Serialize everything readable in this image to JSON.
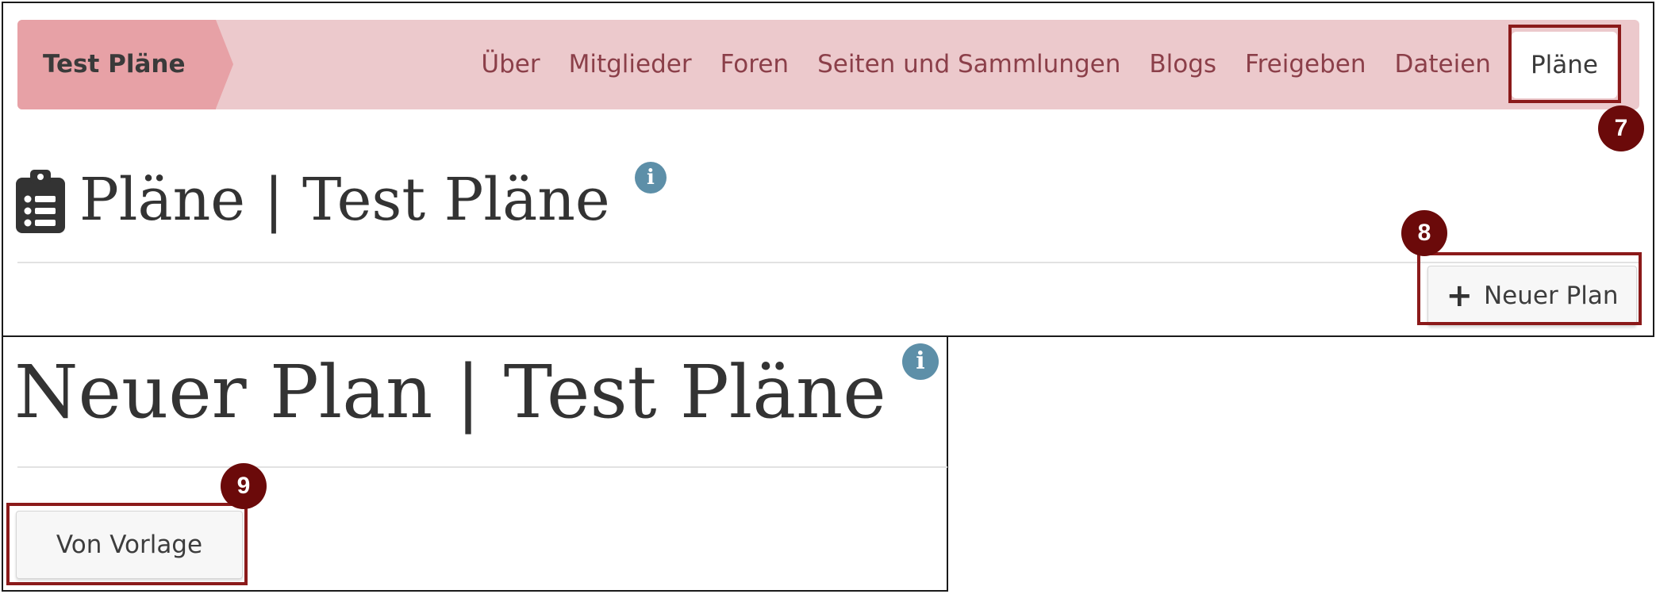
{
  "nav": {
    "group_name": "Test Pläne",
    "items": [
      "Über",
      "Mitglieder",
      "Foren",
      "Seiten und Sammlungen",
      "Blogs",
      "Freigeben",
      "Dateien"
    ],
    "active": "Pläne"
  },
  "top": {
    "heading": "Pläne | Test Pläne",
    "info_icon": "i",
    "new_plan_button": "Neuer Plan"
  },
  "bottom": {
    "heading": "Neuer Plan | Test Pläne",
    "info_icon": "i",
    "template_button": "Von Vorlage"
  },
  "annotations": {
    "step_7": "7",
    "step_8": "8",
    "step_9": "9"
  },
  "colors": {
    "navbar": "#ecc9cc",
    "group_tab": "#e7a1a6",
    "nav_link": "#8b3f49",
    "highlight": "#8b1a1a",
    "badge": "#6b0a0a",
    "info": "#5d8fa8"
  },
  "icons": {
    "page_icon": "clipboard-list-icon",
    "info": "info-icon",
    "add": "plus-icon"
  }
}
